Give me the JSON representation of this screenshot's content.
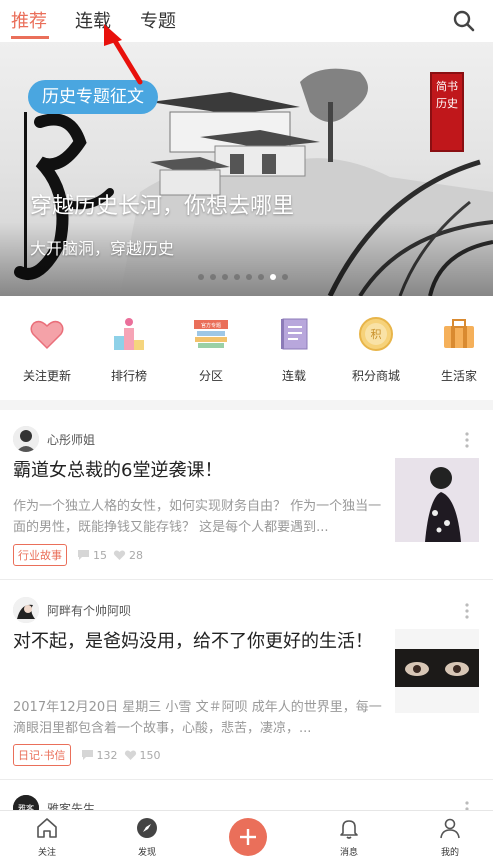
{
  "topnav": {
    "tabs": [
      {
        "label": "推荐",
        "active": true
      },
      {
        "label": "连载",
        "active": false
      },
      {
        "label": "专题",
        "active": false
      }
    ],
    "search_icon": "search-icon"
  },
  "banner": {
    "tag": "历史专题征文",
    "title": "穿越历史长河，你想去哪里",
    "subtitle": "大开脑洞，穿越历史",
    "seal_text": "简书历史",
    "dots_total": 8,
    "dots_active_index": 6
  },
  "categories": [
    {
      "label": "关注更新",
      "icon": "heart-icon"
    },
    {
      "label": "排行榜",
      "icon": "podium-icon"
    },
    {
      "label": "分区",
      "icon": "books-icon",
      "icon_text": "官方专题"
    },
    {
      "label": "连载",
      "icon": "notebook-icon"
    },
    {
      "label": "积分商城",
      "icon": "coin-icon",
      "icon_text": "积"
    },
    {
      "label": "生活家",
      "icon": "suitcase-icon"
    }
  ],
  "feed": [
    {
      "author": "心彤师姐",
      "title": "霸道女总裁的6堂逆袭课！",
      "desc": "作为一个独立人格的女性，如何实现财务自由？ 作为一个独当一面的男性，既能挣钱又能存钱？ 这是每个人都要遇到...",
      "badge": "行业故事",
      "comments": "15",
      "likes": "28"
    },
    {
      "author": "阿畔有个帅阿呗",
      "title": "对不起，是爸妈没用，给不了你更好的生活！",
      "desc": "2017年12月20日 星期三 小雪 文＃阿呗 成年人的世界里，每一滴眼泪里都包含着一个故事，心酸，悲苦，凄凉，...",
      "badge": "日记·书信",
      "comments": "132",
      "likes": "150"
    },
    {
      "author": "雅客先生",
      "avatar_text": "雅客"
    }
  ],
  "bottomnav": [
    {
      "label": "关注",
      "icon": "home-icon"
    },
    {
      "label": "发现",
      "icon": "compass-icon"
    },
    {
      "label": "",
      "icon": "plus-icon"
    },
    {
      "label": "消息",
      "icon": "bell-icon"
    },
    {
      "label": "我的",
      "icon": "person-icon"
    }
  ],
  "colors": {
    "accent": "#ea6f5a",
    "tag_blue": "#4aa6e0",
    "seal_red": "#c0171b"
  }
}
